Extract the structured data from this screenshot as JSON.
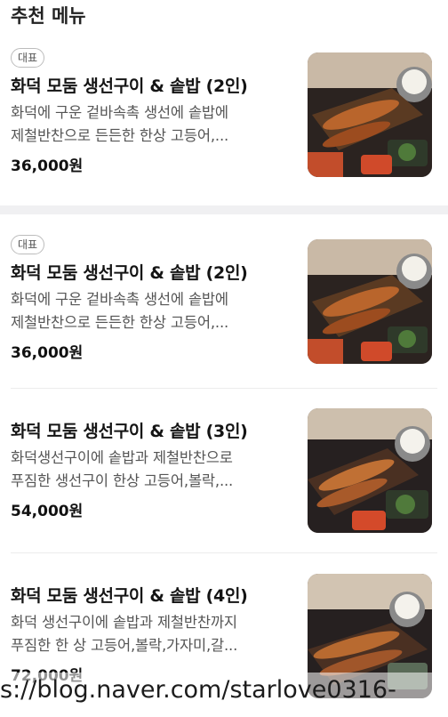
{
  "section": {
    "title": "추천 메뉴"
  },
  "menu": [
    {
      "badge": "대표",
      "name": "화덕 모둠 생선구이 & 솥밥 (2인)",
      "desc_line1": "화덕에 구운 겉바속촉 생선에 솥밥에",
      "desc_line2": "제철반찬으로 든든한 한상 고등어,...",
      "price": "36,000원"
    },
    {
      "badge": "대표",
      "name": "화덕 모둠 생선구이 & 솥밥 (2인)",
      "desc_line1": "화덕에 구운 겉바속촉 생선에 솥밥에",
      "desc_line2": "제철반찬으로 든든한 한상 고등어,...",
      "price": "36,000원"
    },
    {
      "name": "화덕 모둠 생선구이 & 솥밥 (3인)",
      "desc_line1": "화덕생선구이에 솥밥과 제철반찬으로",
      "desc_line2": "푸짐한 생선구이 한상 고등어,볼락,...",
      "price": "54,000원"
    },
    {
      "name": "화덕 모둠 생선구이 & 솥밥 (4인)",
      "desc_line1": "화덕 생선구이에 솥밥과 제철반찬까지",
      "desc_line2": "푸짐한 한 상 고등어,볼락,가자미,갈...",
      "price": "72,000원"
    }
  ],
  "watermark": {
    "text": "s://blog.naver.com/starlove0316-"
  }
}
